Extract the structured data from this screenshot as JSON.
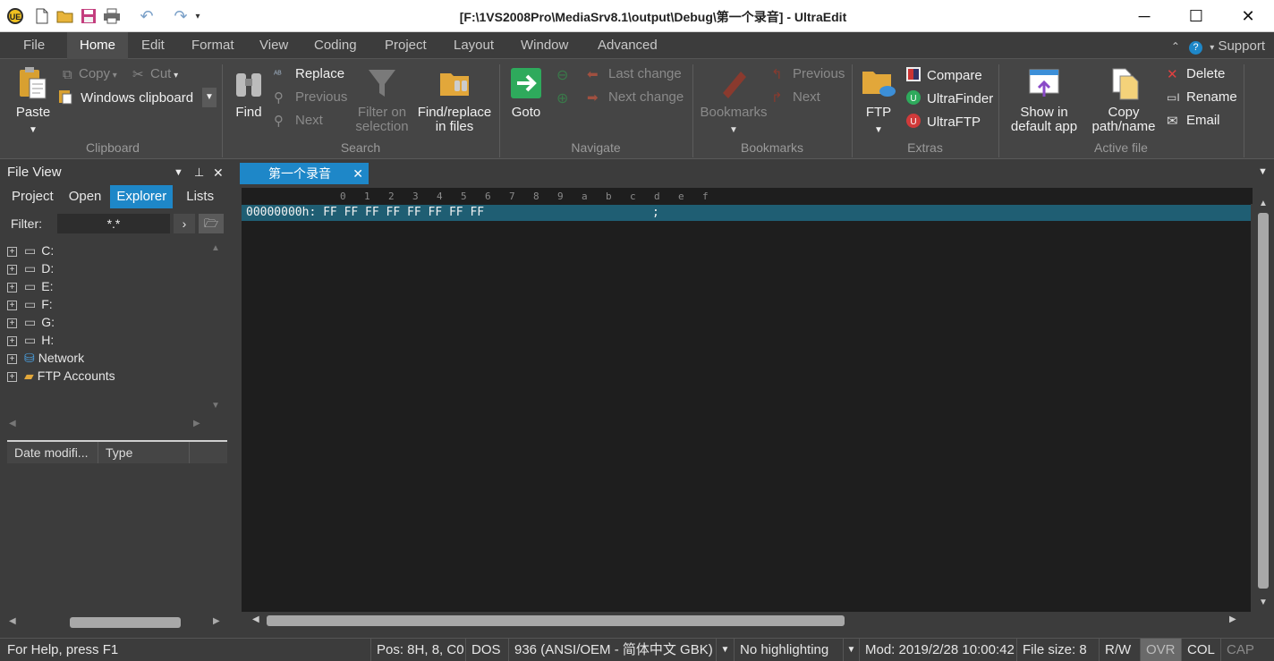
{
  "window": {
    "title": "[F:\\1VS2008Pro\\MediaSrv8.1\\output\\Debug\\第一个录音] - UltraEdit",
    "minimize": "─",
    "maximize": "☐",
    "close": "✕"
  },
  "menu": {
    "tabs": [
      "File",
      "Home",
      "Edit",
      "Format",
      "View",
      "Coding",
      "Project",
      "Layout",
      "Window",
      "Advanced"
    ],
    "active": "Home",
    "support": "Support"
  },
  "ribbon": {
    "clipboard": {
      "label": "Clipboard",
      "paste": "Paste",
      "copy": "Copy",
      "cut": "Cut",
      "clipboard_select": "Windows clipboard"
    },
    "search": {
      "label": "Search",
      "find": "Find",
      "replace": "Replace",
      "previous": "Previous",
      "next": "Next",
      "filter_on_selection_1": "Filter on",
      "filter_on_selection_2": "selection",
      "find_replace_files_1": "Find/replace",
      "find_replace_files_2": "in files"
    },
    "navigate": {
      "label": "Navigate",
      "goto": "Goto",
      "last_change": "Last change",
      "next_change": "Next change"
    },
    "bookmarks": {
      "label": "Bookmarks",
      "bookmarks": "Bookmarks",
      "previous": "Previous",
      "next": "Next"
    },
    "extras": {
      "label": "Extras",
      "ftp": "FTP",
      "compare": "Compare",
      "ultrafinder": "UltraFinder",
      "ultraftp": "UltraFTP"
    },
    "active_file": {
      "label": "Active file",
      "show_default_1": "Show in",
      "show_default_2": "default app",
      "copy_path_1": "Copy",
      "copy_path_2": "path/name",
      "delete": "Delete",
      "rename": "Rename",
      "email": "Email"
    }
  },
  "file_view": {
    "title": "File View",
    "tabs": [
      "Project",
      "Open",
      "Explorer",
      "Lists"
    ],
    "active_tab": "Explorer",
    "filter_label": "Filter:",
    "filter_value": "*.*",
    "tree": [
      "C:",
      "D:",
      "E:",
      "F:",
      "G:",
      "H:",
      "Network",
      "FTP Accounts"
    ],
    "columns": [
      "Date modifi...",
      "Type"
    ]
  },
  "editor": {
    "tab_title": "第一个录音",
    "ruler": [
      "0",
      "1",
      "2",
      "3",
      "4",
      "5",
      "6",
      "7",
      "8",
      "9",
      "a",
      "b",
      "c",
      "d",
      "e",
      "f"
    ],
    "hex_line": "00000000h: FF FF FF FF FF FF FF FF                        ;"
  },
  "status": {
    "help": "For Help, press F1",
    "pos": "Pos: 8H, 8, C0",
    "line_ending": "DOS",
    "encoding": "936   (ANSI/OEM - 简体中文 GBK)",
    "highlighting": "No highlighting",
    "modified": "Mod: 2019/2/28 10:00:42",
    "filesize": "File size: 8",
    "rw": "R/W",
    "ovr": "OVR",
    "col": "COL",
    "cap": "CAP"
  },
  "colors": {
    "accent": "#1e87c8",
    "hex_highlight": "#1f5e73",
    "editor_bg": "#1e1e1e"
  }
}
